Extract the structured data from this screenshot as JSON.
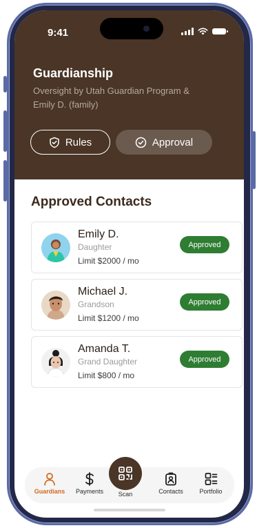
{
  "status_bar": {
    "time": "9:41"
  },
  "header": {
    "title": "Guardianship",
    "subtitle": "Oversight by Utah Guardian Program & Emily D. (family)",
    "buttons": [
      {
        "label": "Rules",
        "icon": "shield-check-icon"
      },
      {
        "label": "Approval",
        "icon": "check-circle-icon"
      }
    ]
  },
  "contacts": {
    "section_title": "Approved Contacts",
    "items": [
      {
        "name": "Emily D.",
        "relation": "Daughter",
        "limit": "Limit $2000 / mo",
        "status": "Approved"
      },
      {
        "name": "Michael J.",
        "relation": "Grandson",
        "limit": "Limit $1200 / mo",
        "status": "Approved"
      },
      {
        "name": "Amanda T.",
        "relation": "Grand Daughter",
        "limit": "Limit $800 / mo",
        "status": "Approved"
      }
    ]
  },
  "nav": {
    "items": [
      {
        "label": "Guardians",
        "icon": "person-icon",
        "active": true
      },
      {
        "label": "Payments",
        "icon": "dollar-icon"
      },
      {
        "label": "Scan",
        "icon": "qr-code-icon"
      },
      {
        "label": "Contacts",
        "icon": "contact-card-icon"
      },
      {
        "label": "Portfolio",
        "icon": "portfolio-list-icon"
      }
    ]
  },
  "colors": {
    "header_bg": "#4a3526",
    "accent": "#d2691e",
    "approved_badge": "#2e7d32"
  }
}
